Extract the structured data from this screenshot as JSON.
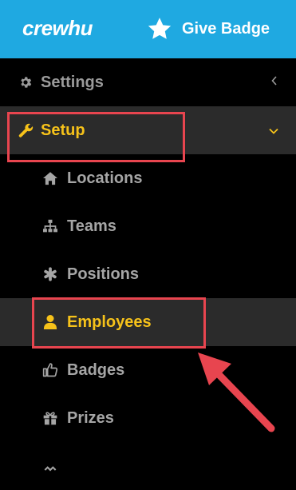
{
  "header": {
    "logo_text": "crewhu",
    "give_badge_label": "Give Badge",
    "give_badge_icon": "star-icon",
    "background_color": "#1fa9e1"
  },
  "sidebar": {
    "settings": {
      "label": "Settings",
      "icon": "gear-icon",
      "caret": "chevron-left-icon"
    },
    "setup": {
      "label": "Setup",
      "icon": "wrench-icon",
      "caret": "chevron-down-icon",
      "expanded": true
    },
    "items": [
      {
        "label": "Locations",
        "icon": "home-icon"
      },
      {
        "label": "Teams",
        "icon": "sitemap-icon"
      },
      {
        "label": "Positions",
        "icon": "asterisk-icon"
      },
      {
        "label": "Employees",
        "icon": "user-icon",
        "active": true
      },
      {
        "label": "Badges",
        "icon": "thumbs-up-icon"
      },
      {
        "label": "Prizes",
        "icon": "gift-icon"
      }
    ]
  },
  "colors": {
    "active_text": "#f6c21a",
    "inactive_text": "#a5a5a5",
    "highlight_annotation": "#e8454f"
  }
}
